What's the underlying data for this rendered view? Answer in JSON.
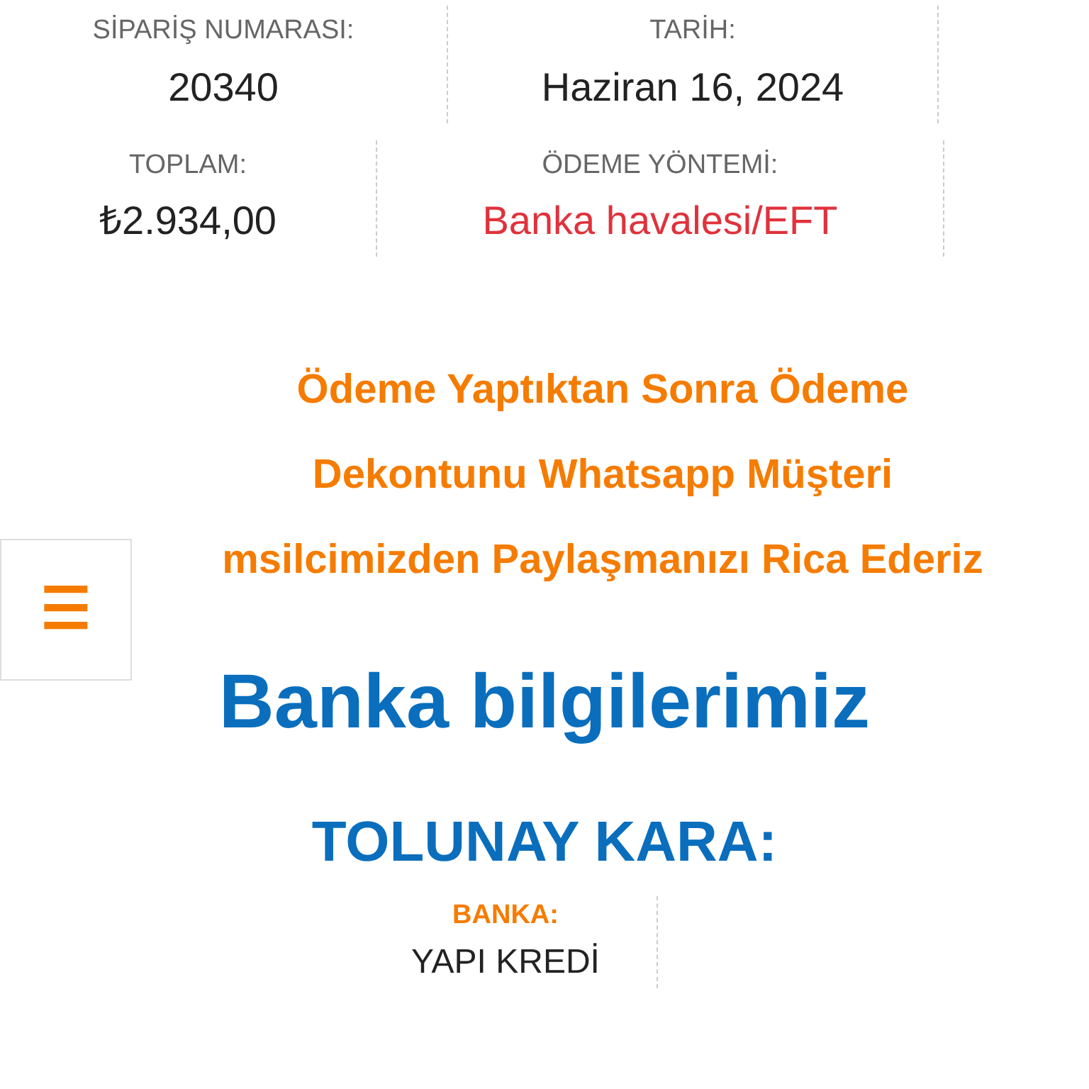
{
  "order_rows": [
    [
      {
        "label": "SİPARİŞ NUMARASI:",
        "value": "20340",
        "kind": "plain"
      },
      {
        "label": "TARİH:",
        "value": "Haziran 16, 2024",
        "kind": "plain"
      }
    ],
    [
      {
        "label": "TOPLAM:",
        "value": "₺2.934,00",
        "kind": "plain"
      },
      {
        "label": "ÖDEME YÖNTEMİ:",
        "value": "Banka havalesi/EFT",
        "kind": "accent"
      }
    ]
  ],
  "notice_lines": [
    "Ödeme Yaptıktan Sonra Ödeme",
    "Dekontunu Whatsapp Müşteri",
    "msilcimizden Paylaşmanızı Rica Ederiz"
  ],
  "menu_button": {
    "icon": "☰"
  },
  "bank_heading": "Banka bilgilerimiz",
  "account_name": "TOLUNAY KARA:",
  "bank_fields": [
    {
      "label": "BANKA:",
      "value": "YAPI KREDİ"
    }
  ]
}
